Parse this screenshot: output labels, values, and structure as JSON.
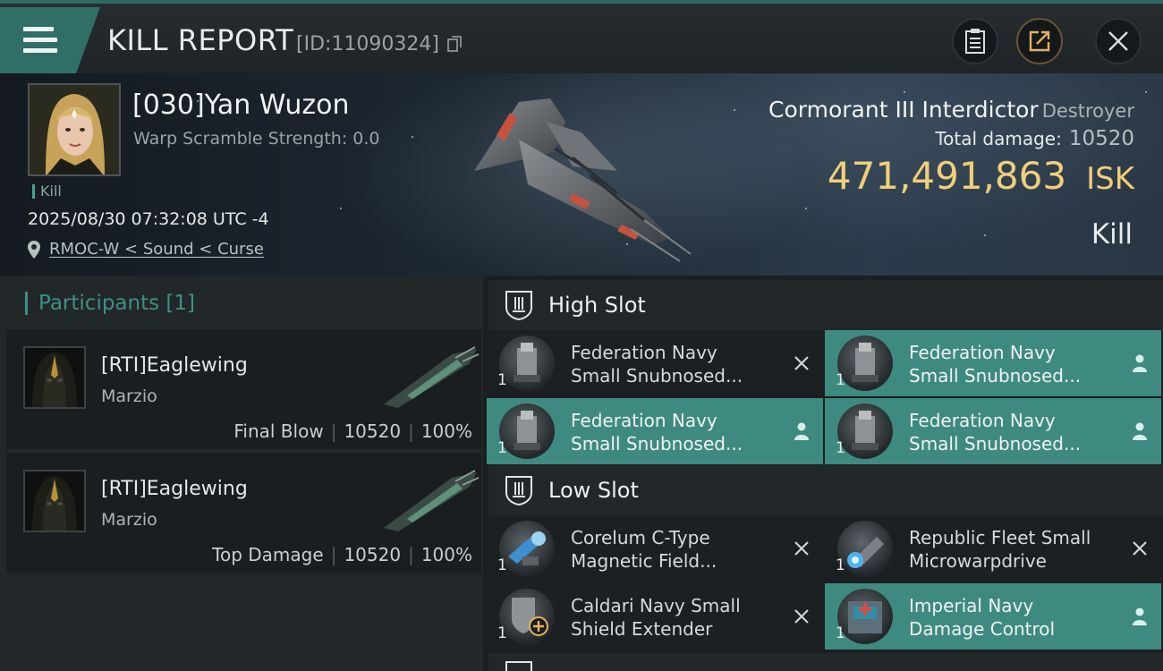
{
  "header": {
    "title": "KILL REPORT",
    "report_id": "[ID:11090324]",
    "icons": [
      "menu-icon",
      "copy-icon",
      "clipboard-icon",
      "share-icon",
      "close-icon"
    ]
  },
  "victim": {
    "name": "[030]Yan Wuzon",
    "warp_scramble": "Warp Scramble Strength: 0.0",
    "tag": "Kill",
    "timestamp": "2025/08/30 07:32:08 UTC -4",
    "location": "RMOC-W < Sound < Curse",
    "ship_name": "Cormorant III Interdictor",
    "ship_class": "Destroyer",
    "damage_label": "Total damage:",
    "damage_value": "10520",
    "isk_value": "471,491,863",
    "isk_unit": "ISK",
    "result": "Kill"
  },
  "participants": {
    "title": "Participants",
    "count": "[1]",
    "items": [
      {
        "name": "[RTI]Eaglewing",
        "ship": "Marzio",
        "role": "Final Blow",
        "damage": "10520",
        "percent": "100%"
      },
      {
        "name": "[RTI]Eaglewing",
        "ship": "Marzio",
        "role": "Top Damage",
        "damage": "10520",
        "percent": "100%"
      }
    ]
  },
  "fitting": {
    "high_slot": {
      "label": "High Slot",
      "modules": [
        {
          "line1": "Federation Navy",
          "line2": "Small Snubnosed...",
          "qty": "1",
          "status": "destroyed"
        },
        {
          "line1": "Federation Navy",
          "line2": "Small Snubnosed...",
          "qty": "1",
          "status": "dropped"
        },
        {
          "line1": "Federation Navy",
          "line2": "Small Snubnosed...",
          "qty": "1",
          "status": "dropped"
        },
        {
          "line1": "Federation Navy",
          "line2": "Small Snubnosed...",
          "qty": "1",
          "status": "dropped"
        }
      ]
    },
    "low_slot": {
      "label": "Low Slot",
      "modules": [
        {
          "line1": "Corelum C-Type",
          "line2": "Magnetic Field...",
          "qty": "1",
          "status": "destroyed"
        },
        {
          "line1": "Republic Fleet Small",
          "line2": "Microwarpdrive",
          "qty": "1",
          "status": "destroyed"
        },
        {
          "line1": "Caldari Navy Small",
          "line2": "Shield Extender",
          "qty": "1",
          "status": "destroyed"
        },
        {
          "line1": "Imperial Navy",
          "line2": "Damage Control",
          "qty": "1",
          "status": "dropped"
        }
      ]
    }
  },
  "colors": {
    "accent": "#3f8a80",
    "isk": "#f0cf7a",
    "background": "#1b1f22"
  }
}
